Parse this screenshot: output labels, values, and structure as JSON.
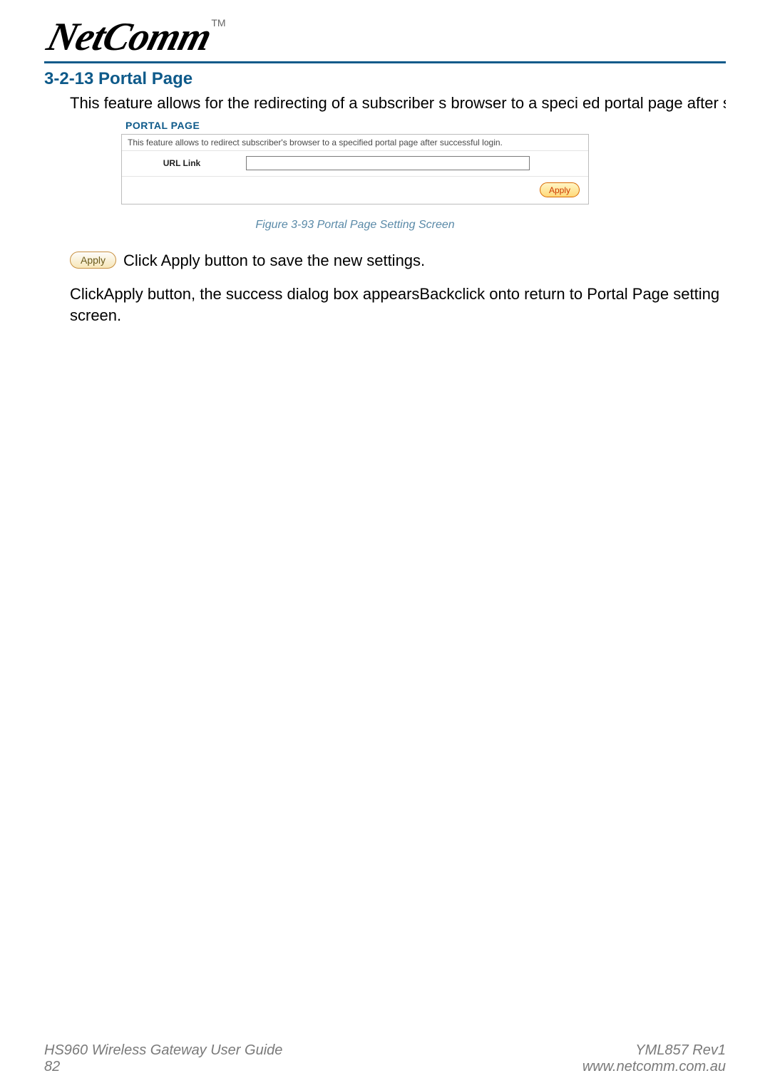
{
  "brand": {
    "name": "NetComm",
    "tm": "TM"
  },
  "section": {
    "number": "3-2-13",
    "title": "Portal Page",
    "intro": "This feature allows for the redirecting of a subscriber s browser to a speci ed portal page after suc"
  },
  "figure": {
    "panel_title": "PORTAL PAGE",
    "panel_desc": "This feature allows to redirect subscriber's browser to a specified portal page after successful login.",
    "url_label": "URL Link",
    "apply_label": "Apply",
    "caption": "Figure 3-93 Portal Page Setting Screen"
  },
  "body": {
    "inline_apply_label": "Apply",
    "line1": "Click Apply button to save the new settings.",
    "line2_a": "Click",
    "line2_b": "Apply button, the success dialog box appears",
    "line2_c": "Back",
    "line2_d": "click on",
    "line2_e": "to return to Portal Page setting screen."
  },
  "footer": {
    "guide": "HS960 Wireless Gateway User Guide",
    "page": "82",
    "rev": "YML857 Rev1",
    "url": "www.netcomm.com.au"
  }
}
